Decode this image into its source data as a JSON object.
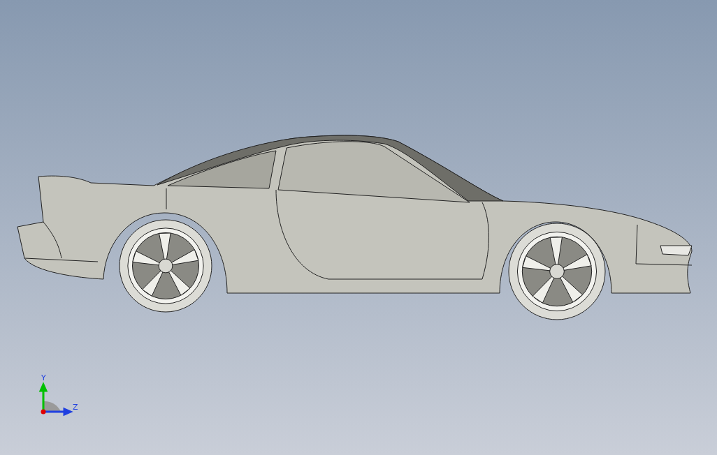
{
  "viewport": {
    "triad": {
      "axes": [
        {
          "label": "Y",
          "kind": "vertical",
          "color": "#00c000"
        },
        {
          "label": "Z",
          "kind": "horizontal",
          "color": "#1f3fe0"
        }
      ]
    }
  }
}
